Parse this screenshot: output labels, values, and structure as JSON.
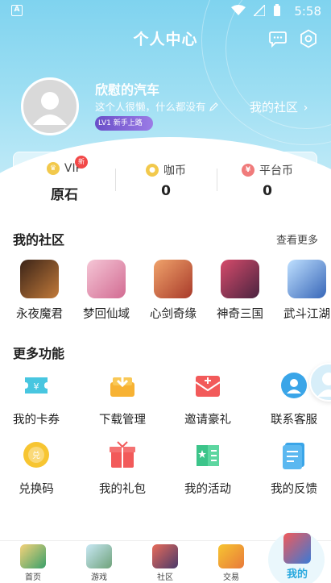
{
  "status_bar": {
    "left_glyph": "A",
    "time": "5:58"
  },
  "header": {
    "title": "个人中心",
    "icons": [
      "chat-icon",
      "settings-icon"
    ]
  },
  "profile": {
    "username": "欣慰的汽车",
    "bio": "这个人很懒，什么都没有",
    "level_text": "LV1 新手上路",
    "community_link": "我的社区"
  },
  "balances": [
    {
      "label": "VIP",
      "value": "原石",
      "badge": "新",
      "icon": "crown-icon",
      "color": "#f2c94c"
    },
    {
      "label": "咖币",
      "value": "0",
      "icon": "coffee-coin-icon",
      "color": "#f2c94c"
    },
    {
      "label": "平台币",
      "value": "0",
      "icon": "platform-coin-icon",
      "color": "#f07b7b"
    }
  ],
  "community": {
    "title": "我的社区",
    "see_more": "查看更多",
    "games": [
      {
        "name": "永夜魔君",
        "color": "#8a4a2b"
      },
      {
        "name": "梦回仙域",
        "color": "#e79ab5"
      },
      {
        "name": "心剑奇缘",
        "color": "#c7563b"
      },
      {
        "name": "神奇三国",
        "color": "#b73b54"
      },
      {
        "name": "武斗江湖",
        "color": "#5a8ed6"
      }
    ]
  },
  "more_features": {
    "title": "更多功能",
    "items": [
      {
        "label": "我的卡券",
        "icon": "coupon-icon",
        "color": "#48c6e0"
      },
      {
        "label": "下载管理",
        "icon": "download-icon",
        "color": "#f7b233"
      },
      {
        "label": "邀请豪礼",
        "icon": "invite-gift-icon",
        "color": "#f25a5a"
      },
      {
        "label": "联系客服",
        "icon": "customer-service-icon",
        "color": "#3aa5e8"
      },
      {
        "label": "兑换码",
        "icon": "redeem-code-icon",
        "color": "#f7c531"
      },
      {
        "label": "我的礼包",
        "icon": "gift-pack-icon",
        "color": "#f25a5a"
      },
      {
        "label": "我的活动",
        "icon": "activity-book-icon",
        "color": "#3cc48a"
      },
      {
        "label": "我的反馈",
        "icon": "feedback-icon",
        "color": "#3aa5e8"
      }
    ]
  },
  "tab_bar": {
    "tabs": [
      {
        "label": "首页",
        "icon": "home-tab-icon",
        "active": false
      },
      {
        "label": "游戏",
        "icon": "games-tab-icon",
        "active": false
      },
      {
        "label": "社区",
        "icon": "community-tab-icon",
        "active": false
      },
      {
        "label": "交易",
        "icon": "trade-tab-icon",
        "active": false
      },
      {
        "label": "我的",
        "icon": "profile-tab-icon",
        "active": true
      }
    ]
  }
}
